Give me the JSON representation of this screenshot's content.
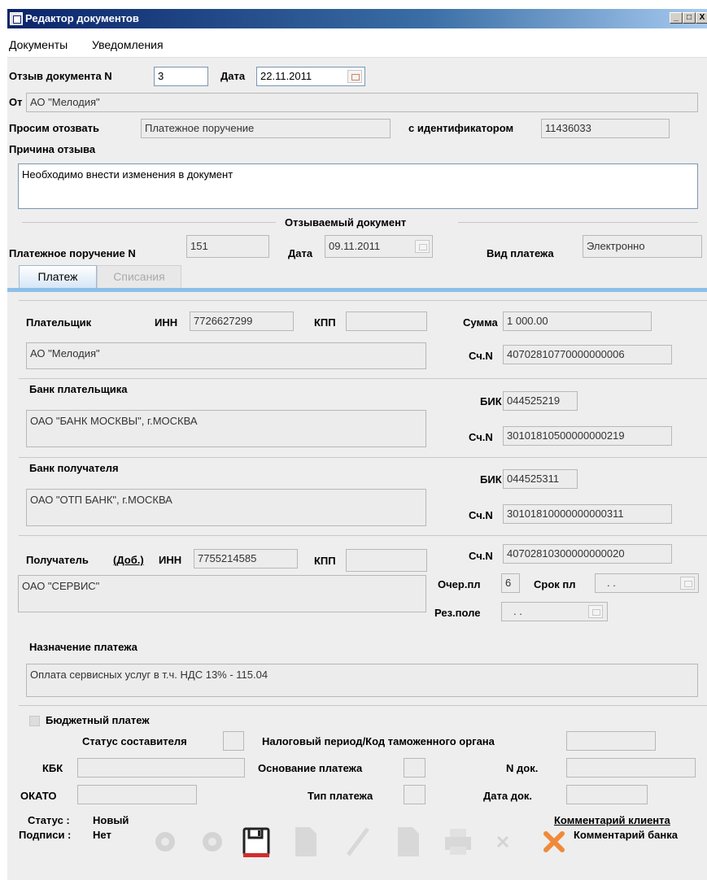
{
  "window": {
    "title": "Редактор документов",
    "buttons": [
      "_",
      "□",
      "X"
    ]
  },
  "menu": [
    "Документы",
    "Уведомления"
  ],
  "recall": {
    "num_label": "Отзыв документа N",
    "num_value": "3",
    "date_label": "Дата",
    "date_value": "22.11.2011",
    "from_label": "От",
    "from_value": "АО \"Мелодия\"",
    "ask_label": "Просим отозвать",
    "ask_value": "Платежное поручение",
    "id_label": "с идентификатором",
    "id_value": "11436033",
    "reason_label": "Причина отзыва",
    "reason_value": "Необходимо внести изменения в документ"
  },
  "recalled": {
    "section_title": "Отзываемый документ",
    "pp_label": "Платежное поручение N",
    "pp_value": "151",
    "date_label": "Дата",
    "date_value": "09.11.2011",
    "kind_label": "Вид платежа",
    "kind_value": "Электронно"
  },
  "tabs": [
    {
      "label": "Платеж",
      "active": true
    },
    {
      "label": "Списания",
      "active": false
    }
  ],
  "payer": {
    "title": "Плательщик",
    "inn_label": "ИНН",
    "inn_value": "7726627299",
    "kpp_label": "КПП",
    "kpp_value": "",
    "sum_label": "Сумма",
    "sum_value": "1 000.00",
    "name_value": "АО \"Мелодия\"",
    "acc_label": "Сч.N",
    "acc_value": "40702810770000000006"
  },
  "payer_bank": {
    "title": "Банк плательщика",
    "name_value": "ОАО \"БАНК МОСКВЫ\", г.МОСКВА",
    "bik_label": "БИК",
    "bik_value": "044525219",
    "acc_label": "Сч.N",
    "acc_value": "30101810500000000219"
  },
  "payee_bank": {
    "title": "Банк получателя",
    "name_value": "ОАО \"ОТП БАНК\", г.МОСКВА",
    "bik_label": "БИК",
    "bik_value": "044525311",
    "acc_label": "Сч.N",
    "acc_value": "30101810000000000311"
  },
  "payee": {
    "title": "Получатель",
    "add_link": "(Доб.)",
    "inn_label": "ИНН",
    "inn_value": "7755214585",
    "kpp_label": "КПП",
    "kpp_value": "",
    "acc_label": "Сч.N",
    "acc_value": "40702810300000000020",
    "name_value": "ОАО \"СЕРВИС\"",
    "queue_label": "Очер.пл",
    "queue_value": "6",
    "term_label": "Срок пл",
    "term_value": ". .",
    "res_label": "Рез.поле",
    "res_value": ". ."
  },
  "purpose": {
    "title": "Назначение платежа",
    "value": "Оплата сервисных услуг в т.ч. НДС 13% - 115.04"
  },
  "budget": {
    "checkbox_label": "Бюджетный платеж",
    "status_label": "Статус составителя",
    "tax_label": "Налоговый период/Код таможенного органа",
    "kbk_label": "КБК",
    "basis_label": "Основание платежа",
    "ndoc_label": "N док.",
    "okato_label": "ОКАТО",
    "type_label": "Тип платежа",
    "datedoc_label": "Дата док."
  },
  "footer": {
    "status_label": "Статус :",
    "status_value": "Новый",
    "sign_label": "Подписи :",
    "sign_value": "Нет",
    "client_comment": "Комментарий клиента",
    "bank_comment": "Комментарий банка"
  },
  "toolbar": [
    "prev-icon",
    "next-icon",
    "save-icon",
    "import-icon",
    "edit-icon",
    "doc-icon",
    "print-icon",
    "delete-icon",
    "close-icon"
  ],
  "colors": {
    "titlebar": "#0a246a",
    "accent": "#8cc0ea",
    "close": "#f08a3a",
    "save": "#d22c2c"
  }
}
